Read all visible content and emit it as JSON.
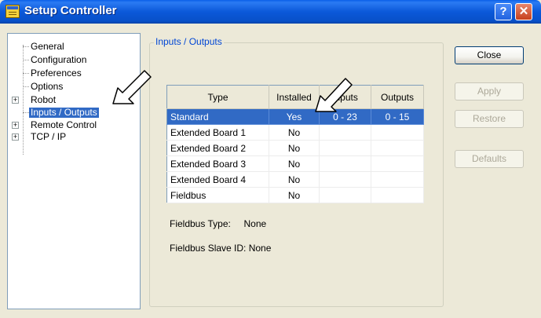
{
  "window": {
    "title": "Setup Controller",
    "help_label": "?",
    "close_label": "✕"
  },
  "tree": {
    "items": [
      {
        "label": "General",
        "expandable": false
      },
      {
        "label": "Configuration",
        "expandable": false
      },
      {
        "label": "Preferences",
        "expandable": false
      },
      {
        "label": "Options",
        "expandable": false
      },
      {
        "label": "Robot",
        "expandable": true
      },
      {
        "label": "Inputs / Outputs",
        "expandable": false,
        "selected": true
      },
      {
        "label": "Remote Control",
        "expandable": true
      },
      {
        "label": "TCP / IP",
        "expandable": true
      }
    ],
    "expander_symbol": "+"
  },
  "panel": {
    "group_title": "Inputs / Outputs",
    "columns": [
      "Type",
      "Installed",
      "Inputs",
      "Outputs"
    ],
    "rows": [
      {
        "type": "Standard",
        "installed": "Yes",
        "inputs": "0 - 23",
        "outputs": "0 - 15",
        "selected": true
      },
      {
        "type": "Extended Board 1",
        "installed": "No",
        "inputs": "",
        "outputs": ""
      },
      {
        "type": "Extended Board 2",
        "installed": "No",
        "inputs": "",
        "outputs": ""
      },
      {
        "type": "Extended Board 3",
        "installed": "No",
        "inputs": "",
        "outputs": ""
      },
      {
        "type": "Extended Board 4",
        "installed": "No",
        "inputs": "",
        "outputs": ""
      },
      {
        "type": "Fieldbus",
        "installed": "No",
        "inputs": "",
        "outputs": ""
      }
    ],
    "fieldbus_type": "Fieldbus Type:     None",
    "fieldbus_slave": "Fieldbus Slave ID: None"
  },
  "buttons": {
    "close": "Close",
    "apply": "Apply",
    "restore": "Restore",
    "defaults": "Defaults"
  },
  "colors": {
    "selection": "#316AC5",
    "titlebar": "#0A5FE8",
    "face": "#ECE9D8"
  }
}
